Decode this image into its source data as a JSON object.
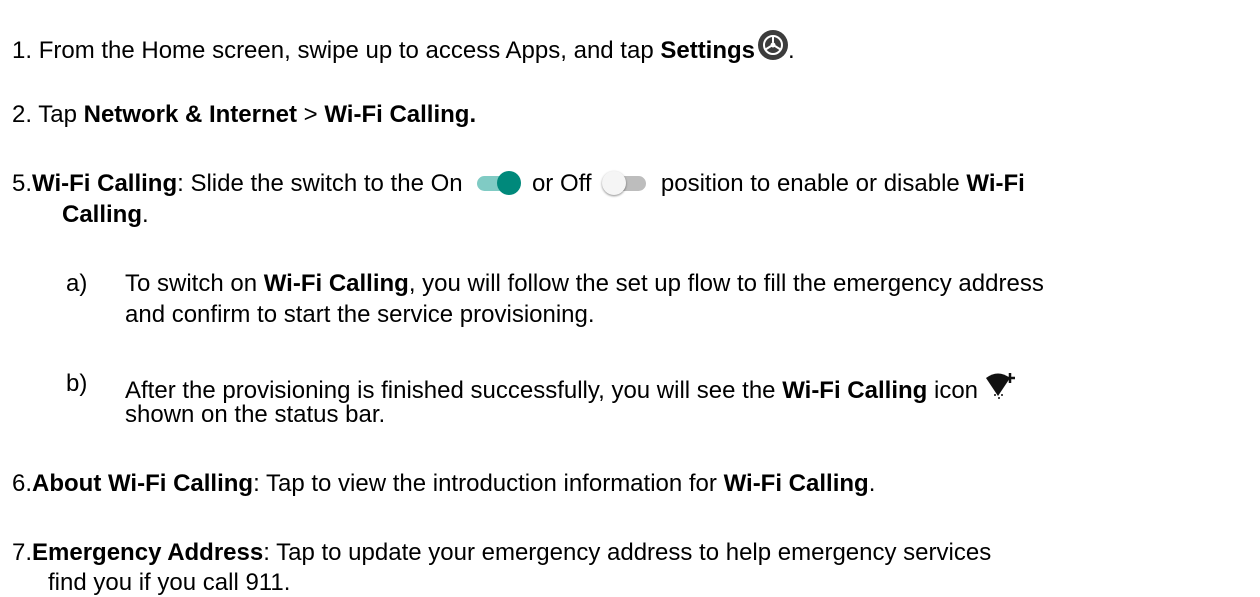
{
  "step1": {
    "number": "1.",
    "text_before": "From the Home screen, swipe up to access Apps, and tap ",
    "bold": "Settings",
    "text_after": ".",
    "icon": "settings-gear-icon"
  },
  "step2": {
    "number": "2.",
    "text_before": "Tap ",
    "bold1": "Network & Internet",
    "separator": " > ",
    "bold2": "Wi-Fi Calling."
  },
  "step5": {
    "number": "5.",
    "bold_label": "Wi-Fi Calling",
    "text1": ": Slide the switch to the On ",
    "text2": " or Off ",
    "text3": " position to enable or disable ",
    "bold_end_1": "Wi-Fi",
    "bold_end_2": "Calling",
    "text_end": ".",
    "toggle_on_icon": "toggle-on-icon",
    "toggle_off_icon": "toggle-off-icon",
    "colors": {
      "toggle_on_thumb": "#00897b",
      "toggle_on_track": "#80cbc4",
      "toggle_off_track": "#bdbdbd"
    },
    "sub_a": {
      "marker": "a)",
      "text_before": "To switch on ",
      "bold": "Wi-Fi Calling",
      "text_after": ", you will follow the set up flow to fill the emergency address",
      "line2": "and confirm to start the service provisioning."
    },
    "sub_b": {
      "marker": "b)",
      "text_before": "After the provisioning is finished successfully, you will see the ",
      "bold": "Wi-Fi Calling",
      "text_after": " icon",
      "line2": "shown on the status bar.",
      "icon": "wifi-calling-icon"
    }
  },
  "step6": {
    "number": "6.",
    "bold_label": "About Wi-Fi Calling",
    "text": ": Tap to view the introduction information for ",
    "bold_end": "Wi-Fi Calling",
    "text_end": "."
  },
  "step7": {
    "number": "7.",
    "bold_label": "Emergency Address",
    "text": ": Tap to update your emergency address to help emergency services",
    "line2": "find you if you call 911."
  }
}
